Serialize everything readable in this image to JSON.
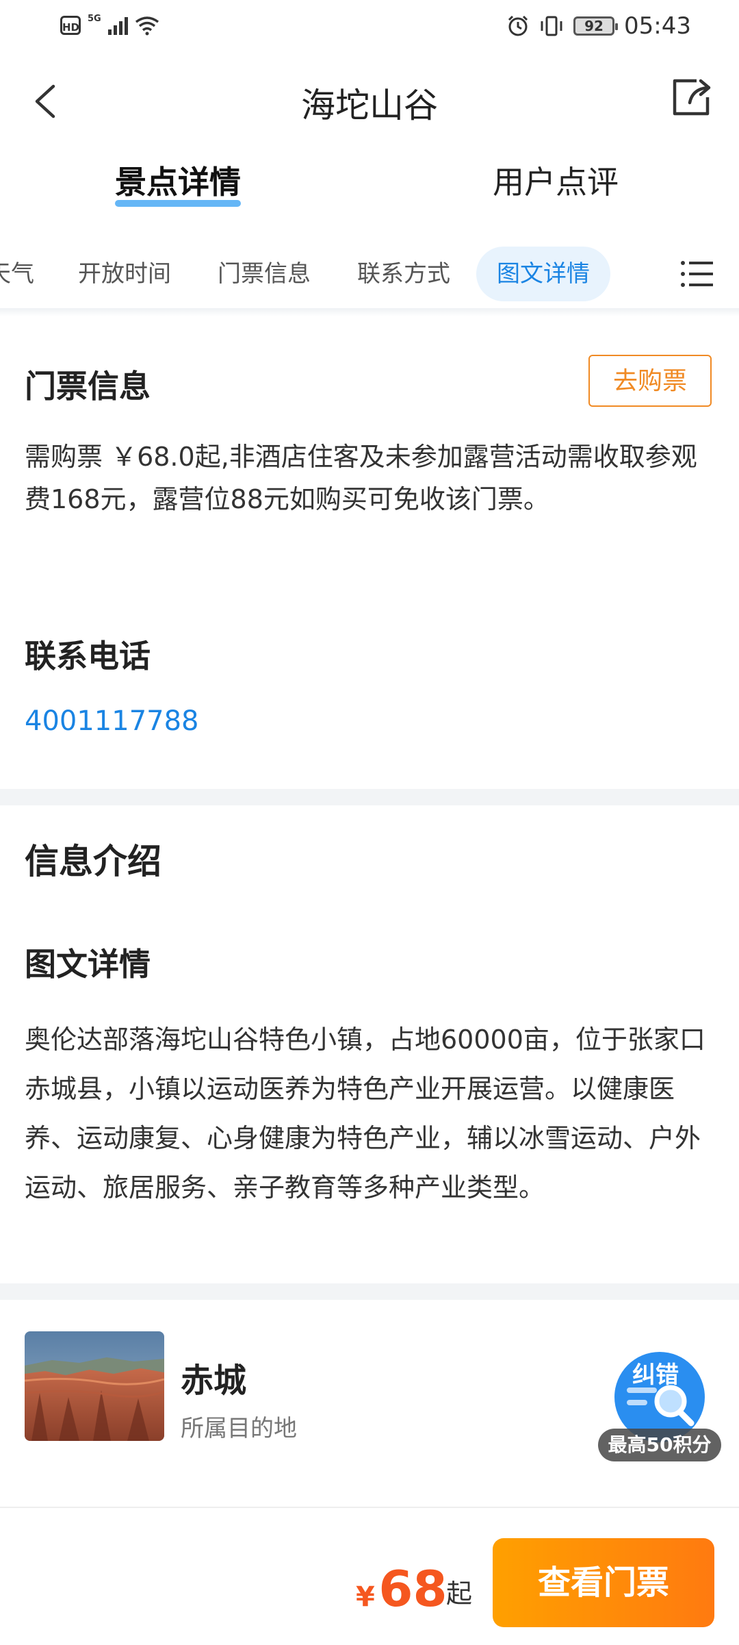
{
  "status_bar": {
    "hd": "HD",
    "network": "5G",
    "battery": "92",
    "time": "05:43"
  },
  "nav": {
    "title": "海坨山谷"
  },
  "main_tabs": [
    {
      "label": "景点详情",
      "active": true
    },
    {
      "label": "用户点评",
      "active": false
    }
  ],
  "sub_tabs": [
    {
      "label": "天气",
      "active": false
    },
    {
      "label": "开放时间",
      "active": false
    },
    {
      "label": "门票信息",
      "active": false
    },
    {
      "label": "联系方式",
      "active": false
    },
    {
      "label": "图文详情",
      "active": true
    }
  ],
  "ticket": {
    "heading": "门票信息",
    "buy_label": "去购票",
    "text": "需购票 ￥68.0起,非酒店住客及未参加露营活动需收取参观费168元，露营位88元如购买可免收该门票。"
  },
  "contact": {
    "heading": "联系电话",
    "phone": "4001117788"
  },
  "info": {
    "heading": "信息介绍",
    "detail_heading": "图文详情",
    "text": "奥伦达部落海坨山谷特色小镇，占地60000亩，位于张家口赤城县，小镇以运动医养为特色产业开展运营。以健康医养、运动康复、心身健康为特色产业，辅以冰雪运动、户外运动、旅居服务、亲子教育等多种产业类型。"
  },
  "destination": {
    "name": "赤城",
    "subtitle": "所属目的地"
  },
  "report": {
    "title": "纠错",
    "badge": "最高50积分"
  },
  "bottom": {
    "currency": "¥",
    "price": "68",
    "suffix": "起",
    "cta": "查看门票"
  },
  "colors": {
    "accent_blue": "#1a84e3",
    "accent_orange": "#f08a24",
    "price_red": "#f5571f"
  }
}
